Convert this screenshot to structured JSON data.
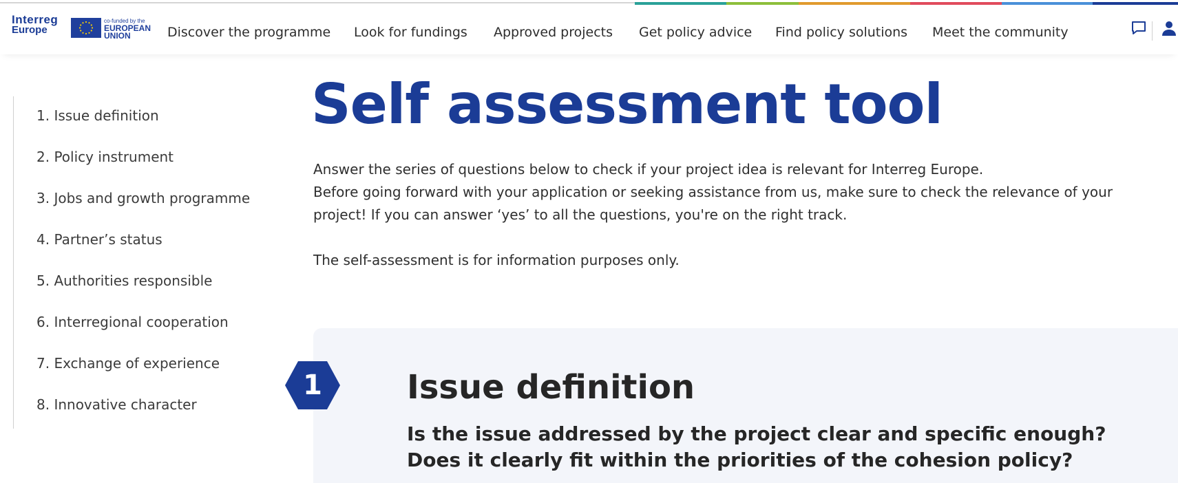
{
  "colors": {
    "brand_blue": "#1b3c96",
    "stripe": [
      "#2aa198",
      "#8dbf3b",
      "#e09a2d",
      "#e04b5c",
      "#c2185b",
      "#4a90d9",
      "#1b3c96"
    ]
  },
  "header": {
    "logo_line1": "Interreg",
    "logo_line2": "Europe",
    "eu_small": "co-funded by the",
    "eu_line1": "EUROPEAN",
    "eu_line2": "UNION",
    "nav": [
      {
        "label": "Discover the programme"
      },
      {
        "label": "Look for fundings"
      },
      {
        "label": "Approved projects"
      },
      {
        "label": "Get policy advice"
      },
      {
        "label": "Find policy solutions"
      },
      {
        "label": "Meet the community"
      }
    ],
    "icons": [
      "chat-icon",
      "user-icon"
    ]
  },
  "sidebar": {
    "items": [
      {
        "label": "1. Issue definition"
      },
      {
        "label": "2. Policy instrument"
      },
      {
        "label": "3. Jobs and growth programme"
      },
      {
        "label": "4. Partner’s status"
      },
      {
        "label": "5. Authorities responsible"
      },
      {
        "label": "6. Interregional cooperation"
      },
      {
        "label": "7. Exchange of experience"
      },
      {
        "label": "8. Innovative character"
      }
    ]
  },
  "main": {
    "title": "Self assessment tool",
    "intro_lines": [
      "Answer the series of questions below to check if your project idea is relevant for Interreg Europe.",
      "Before going forward with your application or seeking assistance from us, make sure to check the relevance of your",
      "project! If you can answer ‘yes’ to all the questions, you're on the right track."
    ],
    "note": "The self-assessment is for information purposes only.",
    "step": {
      "number": "1",
      "title": "Issue definition",
      "questions": [
        "Is the issue addressed by the project clear and specific enough?",
        "Does it clearly fit within the priorities of the cohesion policy?"
      ]
    }
  }
}
